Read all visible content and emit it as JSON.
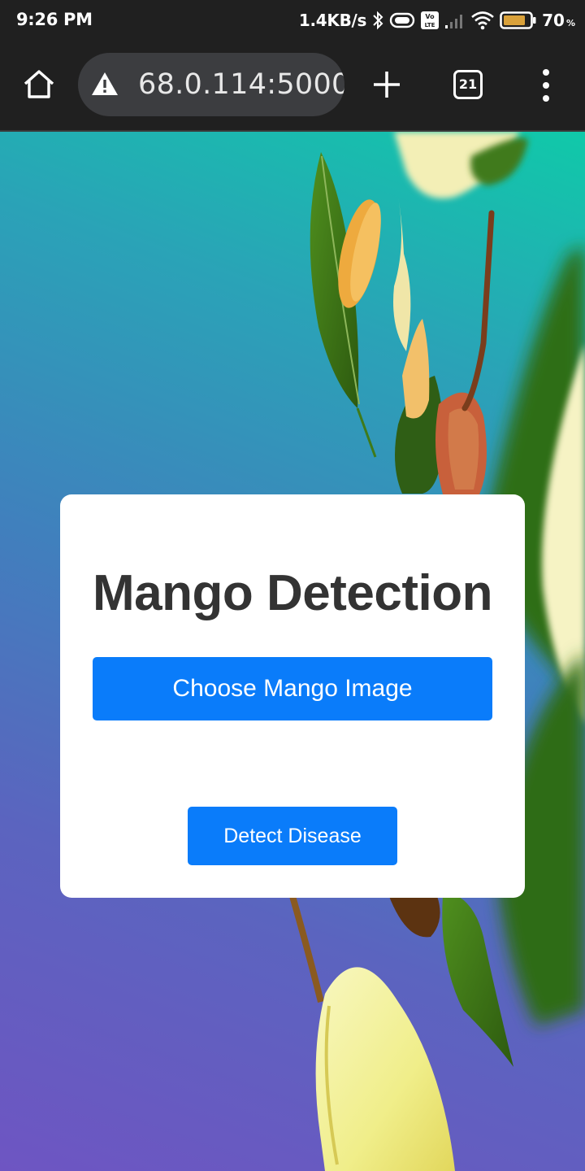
{
  "status_bar": {
    "time": "9:26 PM",
    "network_speed": "1.4KB/s",
    "battery_percent": "70",
    "battery_unit": "%",
    "icons": [
      "bluetooth-icon",
      "hotspot-icon",
      "volte-icon",
      "signal-icon",
      "wifi-icon",
      "battery-icon"
    ]
  },
  "browser": {
    "url": "68.0.114:5000",
    "tab_count": "21",
    "icons": [
      "home-icon",
      "warning-icon",
      "plus-icon",
      "tabs-icon",
      "kebab-menu-icon"
    ]
  },
  "page": {
    "title": "Mango Detection",
    "choose_button": "Choose Mango Image",
    "detect_button": "Detect Disease",
    "colors": {
      "button": "#0a7cfa",
      "title": "#333333",
      "card": "#ffffff",
      "gradient_top": "#10c9a9",
      "gradient_bottom": "#6e55c2"
    }
  }
}
